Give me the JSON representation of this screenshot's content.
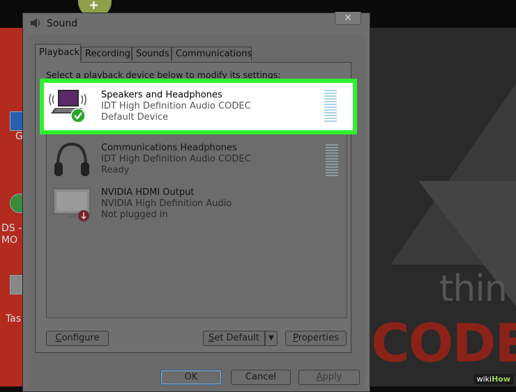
{
  "desktop": {
    "labels": [
      "G",
      "DS -",
      "MO",
      "Tas"
    ],
    "background_text_1": "thin",
    "background_text_2": "CODE"
  },
  "window": {
    "title": "Sound",
    "close_glyph": "✕"
  },
  "tabs": [
    {
      "label": "Playback",
      "active": true
    },
    {
      "label": "Recording",
      "active": false
    },
    {
      "label": "Sounds",
      "active": false
    },
    {
      "label": "Communications",
      "active": false
    }
  ],
  "instruction": "Select a playback device below to modify its settings:",
  "devices": [
    {
      "name": "Speakers and Headphones",
      "driver": "IDT High Definition Audio CODEC",
      "status": "Default Device",
      "icon": "laptop-speaker-icon",
      "badge": "green-check-icon",
      "selected": true
    },
    {
      "name": "Communications Headphones",
      "driver": "IDT High Definition Audio CODEC",
      "status": "Ready",
      "icon": "headphones-icon",
      "selected": false
    },
    {
      "name": "NVIDIA HDMI Output",
      "driver": "NVIDIA High Definition Audio",
      "status": "Not plugged in",
      "icon": "monitor-icon",
      "badge": "red-unplugged-icon",
      "selected": false
    }
  ],
  "buttons": {
    "configure": {
      "first": "C",
      "rest": "onfigure"
    },
    "set_default": {
      "first": "S",
      "rest": "et Default"
    },
    "properties": {
      "first": "P",
      "rest": "roperties"
    },
    "ok": "OK",
    "cancel": "Cancel",
    "apply": {
      "first": "A",
      "rest": "pply"
    }
  },
  "watermark": {
    "wiki": "wiki",
    "how": "How"
  },
  "colors": {
    "highlight_border": "#2ef32e",
    "check_green": "#2aa52a"
  }
}
